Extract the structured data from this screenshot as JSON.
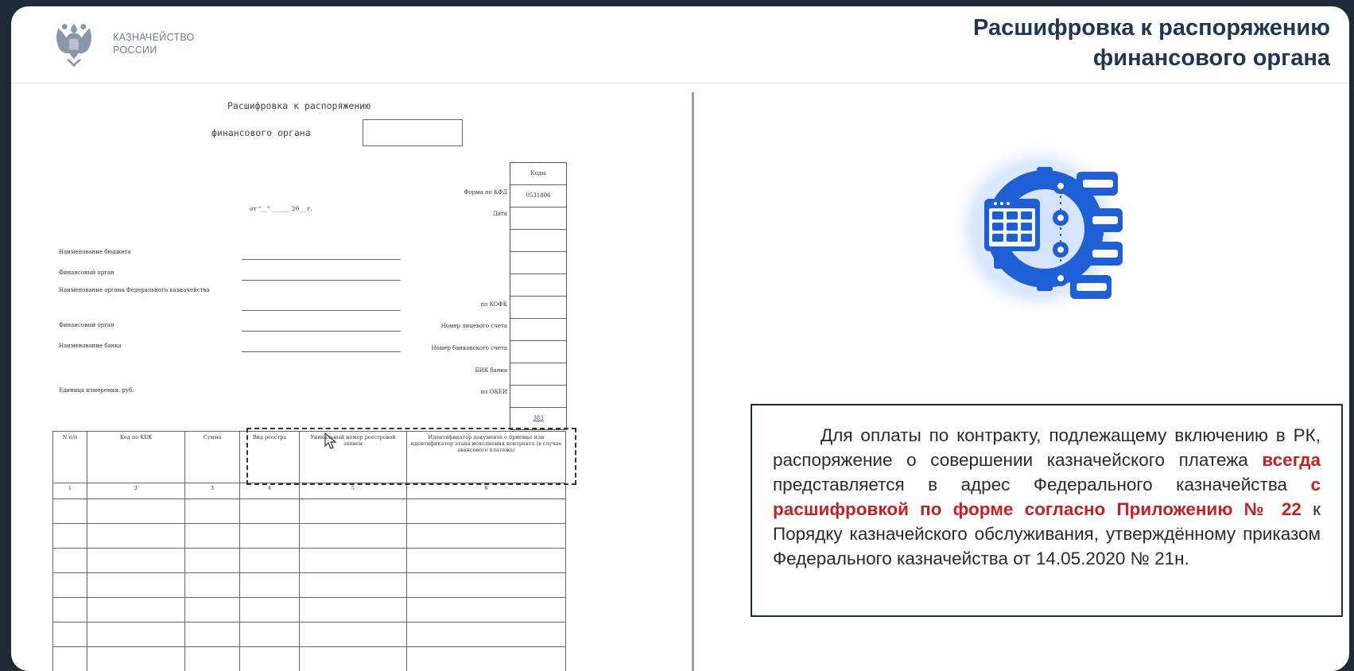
{
  "header": {
    "logo_line1": "КАЗНАЧЕЙСТВО",
    "logo_line2": "РОССИИ",
    "title_line1": "Расшифровка к распоряжению",
    "title_line2": "финансового органа"
  },
  "form": {
    "heading1": "Расшифровка к распоряжению",
    "heading2": "финансового органа",
    "date_line": "от \"__\" ______ 20__ г.",
    "codes_header": "Коды",
    "form_code": "0531806",
    "okei_code": "383",
    "right_labels": [
      "Форма по КФД",
      "Дата",
      "по КОФК",
      "Номер лицевого счета",
      "Номер банковского счета",
      "БИК банка",
      "по ОКЕИ"
    ],
    "left_labels": [
      "Наименование бюджета",
      "Финансовый орган",
      "Наименование органа Федерального казначейства",
      "Финансовый орган",
      "Наименование банка",
      "Единица измерения: руб."
    ],
    "table_headers": [
      "N п/п",
      "Код по КБК",
      "Сумма",
      "Вид реестра",
      "Уникальный номер реестровой записи",
      "Идентификатор документа о приемке или идентификатор этапа исполнения контракта (в случае авансового платежа)"
    ],
    "table_numbers": [
      "1",
      "2",
      "3",
      "4",
      "5",
      "6"
    ]
  },
  "info": {
    "part1": "Для оплаты по контракту, подлежащему включению в РК, распоряжение о совершении казначейского платежа ",
    "highlight1": "всегда",
    "part2": " представляется в адрес Федерального казначейства ",
    "highlight2": "с расшифровкой по форме согласно Приложению № 22",
    "part3": " к Порядку казначейского обслуживания, утверждённому приказом Федерального казначейства от 14.05.2020 № 21н."
  },
  "colors": {
    "title": "#1f3552",
    "accent_red": "#c81f1f",
    "illustration_blue": "#1f5fd6",
    "box_border": "#1a2a44"
  }
}
